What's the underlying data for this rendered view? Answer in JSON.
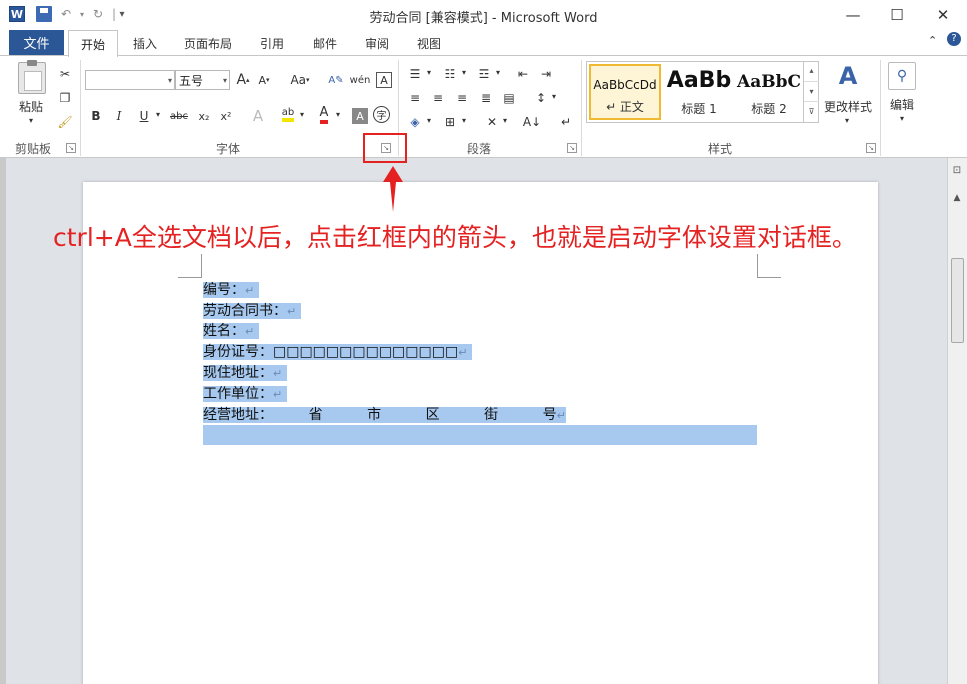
{
  "window": {
    "title": "劳动合同 [兼容模式] - Microsoft Word",
    "logo_letter": "W",
    "controls": {
      "minimize": "—",
      "maximize": "☐",
      "close": "✕"
    }
  },
  "quick_access": {
    "undo": "↶",
    "redo": "↻",
    "customize": "▾"
  },
  "tabs": {
    "file": "文件",
    "items": [
      "开始",
      "插入",
      "页面布局",
      "引用",
      "邮件",
      "审阅",
      "视图"
    ]
  },
  "ribbon": {
    "clipboard": {
      "label": "剪贴板",
      "paste": "粘贴"
    },
    "font": {
      "label": "字体",
      "font_name": "",
      "font_size": "五号",
      "change_case": "Aa",
      "bold": "B",
      "italic": "I",
      "underline": "U",
      "strike": "abc",
      "subscript": "x₂",
      "superscript": "x²"
    },
    "paragraph": {
      "label": "段落"
    },
    "styles": {
      "label": "样式",
      "items": [
        {
          "preview": "AaBbCcDd",
          "name": "↵ 正文",
          "selected": true
        },
        {
          "preview": "AaBb",
          "name": "标题 1",
          "selected": false
        },
        {
          "preview": "AaBbC",
          "name": "标题 2",
          "selected": false
        }
      ],
      "change_styles": "更改样式"
    },
    "editing": {
      "label": "编辑"
    }
  },
  "document": {
    "lines": [
      "编号：",
      "劳动合同书：",
      "姓名：",
      "身份证号：□□□□□□□□□□□□□□",
      "现住地址：",
      "工作单位：",
      "经营地址：        省          市          区          街          号"
    ],
    "paragraph_mark": "↵"
  },
  "annotation": {
    "text": "ctrl+A全选文档以后，点击红框内的箭头，也就是启动字体设置对话框。",
    "color": "#e52222"
  },
  "colors": {
    "accent": "#2b5797",
    "selection": "#a7c9ef",
    "annotation": "#e52222"
  }
}
